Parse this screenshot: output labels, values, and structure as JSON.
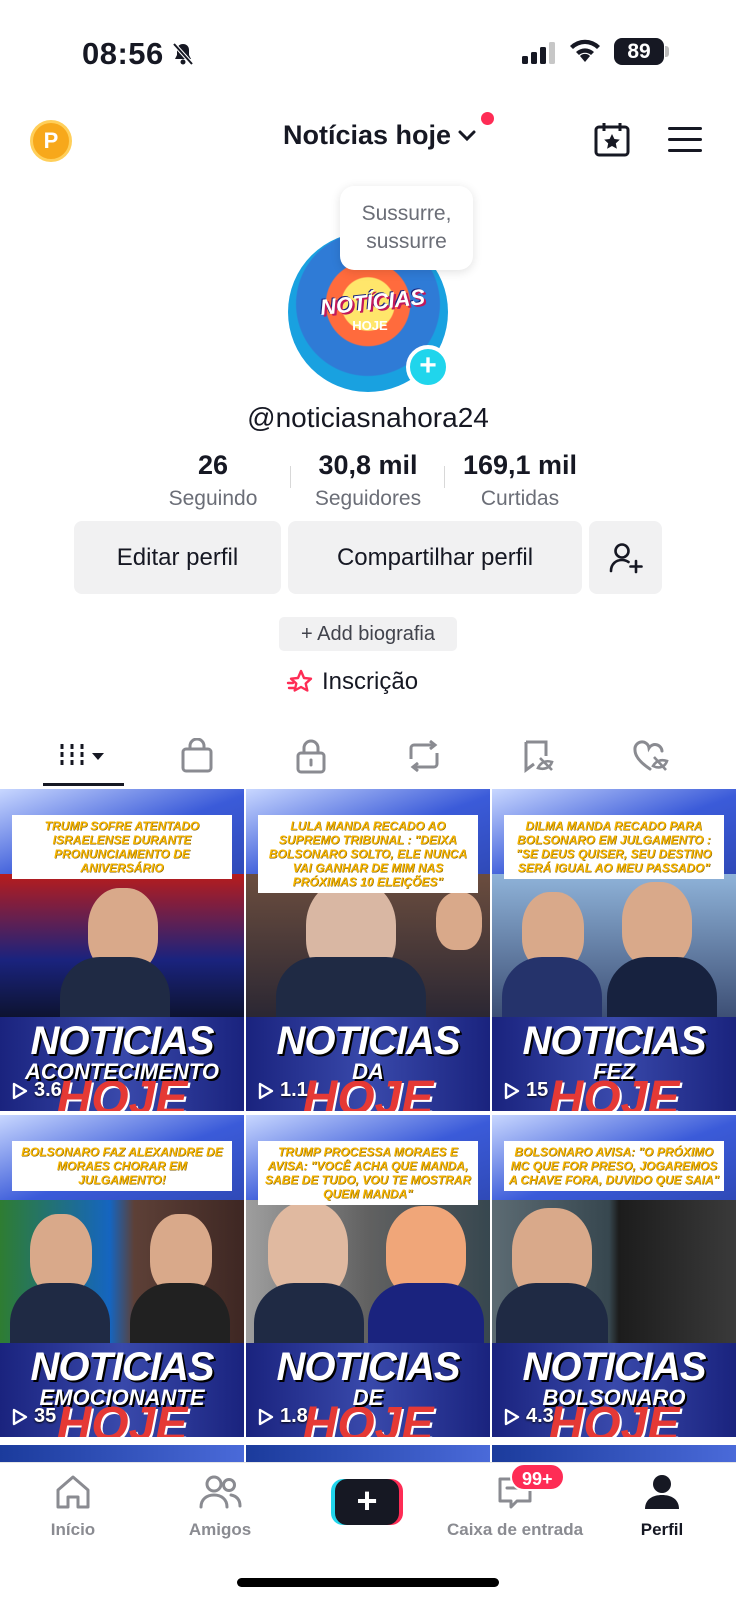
{
  "status_bar": {
    "time": "08:56",
    "battery": "89"
  },
  "header": {
    "account_name": "Notícias hoje",
    "coin_letter": "P"
  },
  "profile": {
    "bubble_text": "Sussurre, sussurre",
    "avatar_title": "NOTÍCIAS",
    "avatar_sub": "HOJE",
    "handle": "@noticiasnahora24",
    "stats": [
      {
        "value": "26",
        "label": "Seguindo"
      },
      {
        "value": "30,8 mil",
        "label": "Seguidores"
      },
      {
        "value": "169,1 mil",
        "label": "Curtidas"
      }
    ],
    "edit_label": "Editar perfil",
    "share_label": "Compartilhar perfil",
    "bio_label": "+ Add biografia",
    "subscription_label": "Inscrição"
  },
  "tabs": [
    {
      "icon": "videos-grid-icon"
    },
    {
      "icon": "shop-bag-icon"
    },
    {
      "icon": "lock-icon"
    },
    {
      "icon": "repost-icon"
    },
    {
      "icon": "saved-icon"
    },
    {
      "icon": "liked-icon"
    }
  ],
  "videos": [
    {
      "headline": "Trump sofre atentado israelense durante pronunciamento de aniversário",
      "word2": "ACONTECIMENTO",
      "word3": "HOJE",
      "views": "3.6"
    },
    {
      "headline": "Lula manda recado ao supremo tribunal : \"Deixa Bolsonaro solto, ele nunca vai ganhar de mim nas próximas 10 eleições\"",
      "word2": "DA",
      "word3": "HOJE",
      "views": "1.1"
    },
    {
      "headline": "Dilma manda recado para Bolsonaro em julgamento : \"Se Deus quiser, seu destino será igual ao meu passado\"",
      "word2": "FEZ",
      "word3": "HOJE",
      "views": "15"
    },
    {
      "headline": "Bolsonaro faz Alexandre de Moraes chorar em julgamento!",
      "word2": "EMOCIONANTE",
      "word3": "HOJE",
      "views": "35"
    },
    {
      "headline": "Trump processa Moraes e avisa: \"Você acha que manda, sabe de tudo, vou te mostrar quem manda\"",
      "word2": "DE",
      "word3": "HOJE",
      "views": "1.8"
    },
    {
      "headline": "Bolsonaro avisa: \"O próximo MC que for preso, jogaremos a chave fora, duvido que saia\"",
      "word2": "BOLSONARO",
      "word3": "HOJE",
      "views": "4.3"
    }
  ],
  "video_banner_word": "NOTICIAS",
  "bottom_nav": {
    "home": "Início",
    "friends": "Amigos",
    "inbox": "Caixa de entrada",
    "inbox_badge": "99+",
    "profile": "Perfil"
  }
}
